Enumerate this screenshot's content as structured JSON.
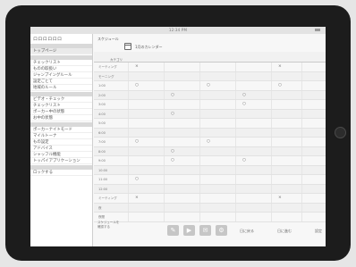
{
  "status_bar": {
    "time": "12:34 PM"
  },
  "sidebar": {
    "title": "ロロロロロロ",
    "items": [
      {
        "type": "head",
        "label": ""
      },
      {
        "type": "item",
        "label": "トップページ",
        "active": true
      },
      {
        "type": "head",
        "label": ""
      },
      {
        "type": "item",
        "label": "チェックリスト"
      },
      {
        "type": "item",
        "label": "ものの取扱い"
      },
      {
        "type": "item",
        "label": "ジャンプイングルール"
      },
      {
        "type": "item",
        "label": "設定ごとて"
      },
      {
        "type": "item",
        "label": "地域のルール"
      },
      {
        "type": "head",
        "label": ""
      },
      {
        "type": "item",
        "label": "ビデオ・チェック"
      },
      {
        "type": "item",
        "label": "チェックリスト"
      },
      {
        "type": "item",
        "label": "ポーカー中の状態"
      },
      {
        "type": "item",
        "label": "お中の状態"
      },
      {
        "type": "head",
        "label": ""
      },
      {
        "type": "item",
        "label": "ポーカーナイトモード"
      },
      {
        "type": "item",
        "label": "マイルトーナ"
      },
      {
        "type": "item",
        "label": "もの設定"
      },
      {
        "type": "item",
        "label": "アドバイス"
      },
      {
        "type": "item",
        "label": "シャッフル機能"
      },
      {
        "type": "item",
        "label": "トッパイアプリケーション"
      },
      {
        "type": "head",
        "label": ""
      },
      {
        "type": "item",
        "label": "ロックする"
      }
    ]
  },
  "main": {
    "header": "スケジュール",
    "unit_label": "",
    "calendar_label": "1月のカレンダー",
    "table": {
      "header_label": "カテゴリ",
      "rows": [
        {
          "label": "ミーティング",
          "marks": [
            "×",
            "",
            "",
            "",
            "×",
            ""
          ]
        },
        {
          "label": "モーニング",
          "marks": [
            "",
            "",
            "",
            "",
            "",
            ""
          ]
        },
        {
          "label": "1:00",
          "marks": [
            "○",
            "",
            "○",
            "",
            "○",
            ""
          ]
        },
        {
          "label": "2:00",
          "marks": [
            "",
            "○",
            "",
            "○",
            "",
            ""
          ]
        },
        {
          "label": "3:00",
          "marks": [
            "",
            "",
            "",
            "○",
            "",
            ""
          ]
        },
        {
          "label": "4:00",
          "marks": [
            "",
            "○",
            "",
            "",
            "",
            ""
          ]
        },
        {
          "label": "5:00",
          "marks": [
            "",
            "",
            "",
            "",
            "",
            ""
          ]
        },
        {
          "label": "6:00",
          "marks": [
            "",
            "",
            "",
            "",
            "",
            ""
          ]
        },
        {
          "label": "7:00",
          "marks": [
            "○",
            "",
            "○",
            "",
            "",
            ""
          ]
        },
        {
          "label": "8:00",
          "marks": [
            "",
            "○",
            "",
            "",
            "",
            ""
          ]
        },
        {
          "label": "9:00",
          "marks": [
            "",
            "○",
            "",
            "○",
            "",
            ""
          ]
        },
        {
          "label": "10:00",
          "marks": [
            "",
            "",
            "",
            "",
            "",
            ""
          ]
        },
        {
          "label": "11:00",
          "marks": [
            "○",
            "",
            "",
            "",
            "",
            ""
          ]
        },
        {
          "label": "12:00",
          "marks": [
            "",
            "",
            "",
            "",
            "",
            ""
          ]
        },
        {
          "label": "ミーティング",
          "marks": [
            "×",
            "",
            "",
            "",
            "×",
            ""
          ]
        },
        {
          "label": "夜",
          "marks": [
            "",
            "",
            "",
            "",
            "",
            ""
          ]
        },
        {
          "label": "夜間",
          "marks": [
            "",
            "",
            "",
            "",
            "",
            ""
          ]
        }
      ]
    },
    "legend": [
      "スケジュールを",
      "確認する"
    ],
    "toolbar": [
      {
        "name": "edit",
        "glyph": "✎"
      },
      {
        "name": "play",
        "glyph": "▶"
      },
      {
        "name": "mail",
        "glyph": "✉"
      },
      {
        "name": "settings",
        "glyph": "⚙"
      }
    ],
    "bottom_links": [
      "日に戻る",
      "日に進む",
      "設定"
    ]
  }
}
